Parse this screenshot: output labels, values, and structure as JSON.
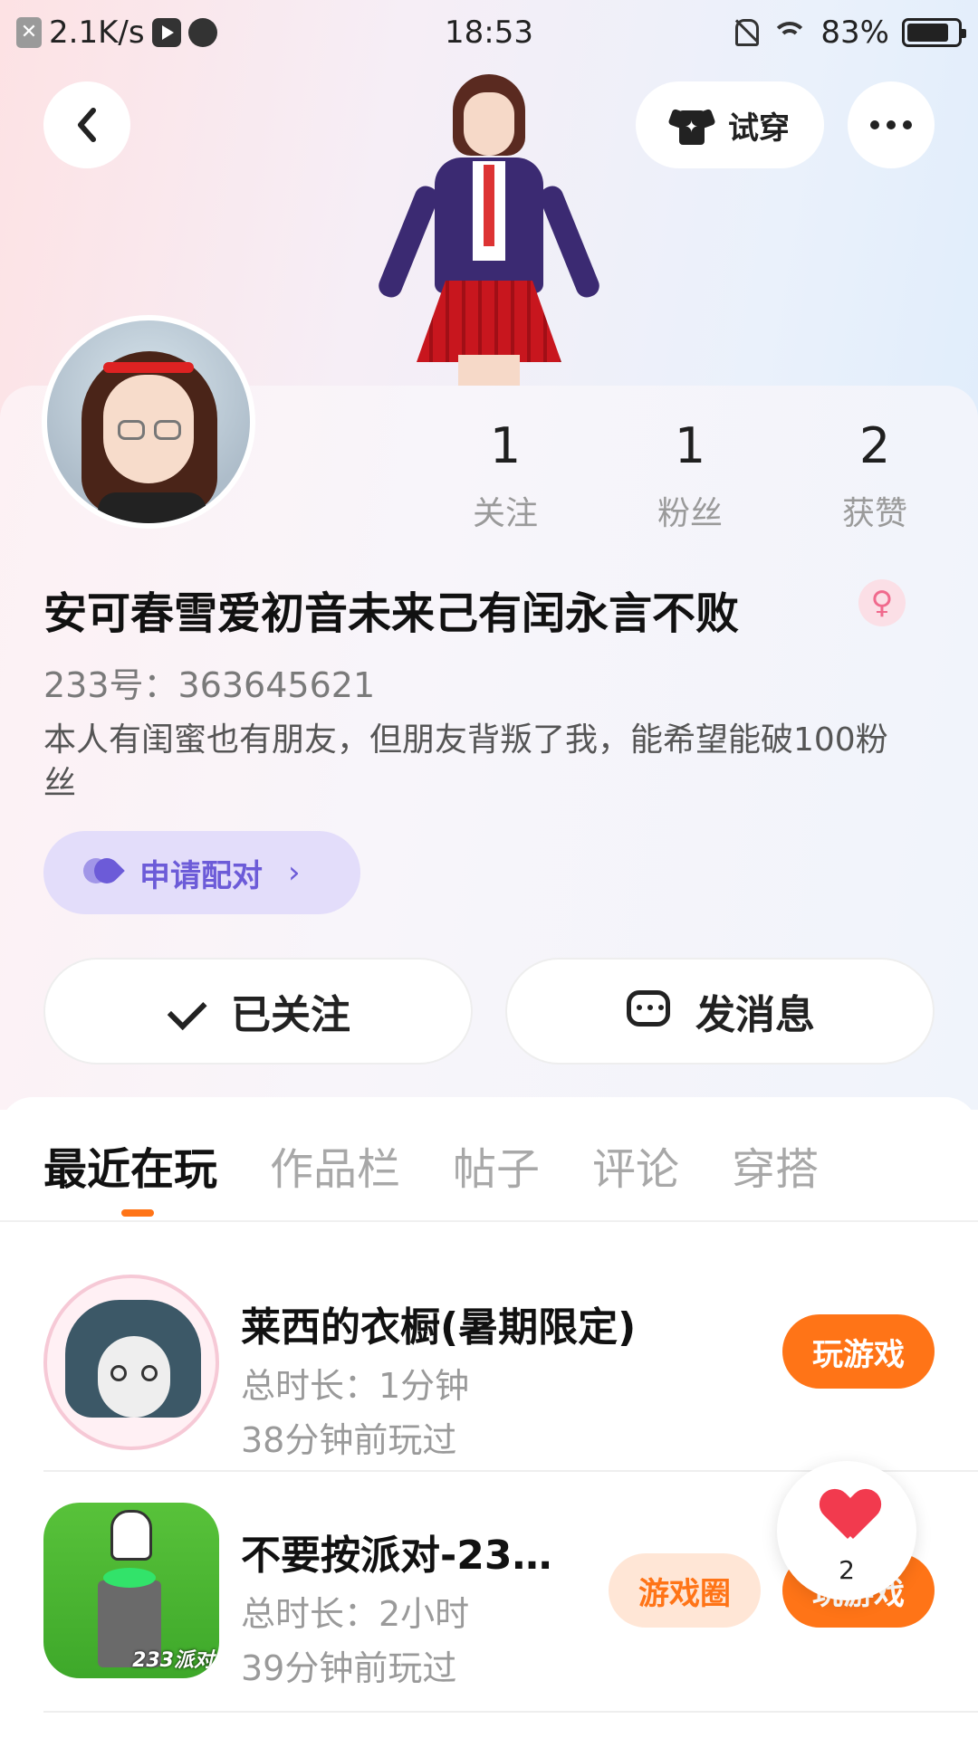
{
  "status_bar": {
    "net_speed": "2.1K/s",
    "time": "18:53",
    "battery": "83%",
    "battery_level": 0.83
  },
  "header": {
    "try_on_label": "试穿"
  },
  "profile": {
    "stats": [
      {
        "value": "1",
        "label": "关注"
      },
      {
        "value": "1",
        "label": "粉丝"
      },
      {
        "value": "2",
        "label": "获赞"
      }
    ],
    "username": "安可春雪爱初音未来己有闰永言不败",
    "gender": "female",
    "uid": "233号：363645621",
    "bio": "本人有闺蜜也有朋友，但朋友背叛了我，能希望能破100粉丝",
    "pair_label": "申请配对",
    "follow_label": "已关注",
    "message_label": "发消息"
  },
  "tabs": [
    "最近在玩",
    "作品栏",
    "帖子",
    "评论",
    "穿搭"
  ],
  "active_tab": "最近在玩",
  "games": [
    {
      "title": "莱西的衣橱(暑期限定)",
      "duration": "总时长：1分钟",
      "last_played": "38分钟前玩过",
      "play_label": "玩游戏"
    },
    {
      "title": "不要按派对-23…",
      "duration": "总时长：2小时",
      "last_played": "39分钟前玩过",
      "circle_label": "游戏圈",
      "play_label": "玩游戏",
      "icon_text": "233派对"
    }
  ],
  "like_float": {
    "count": "2"
  },
  "colors": {
    "accent": "#ff7417",
    "pair_purple": "#6c5bd8",
    "heart_red": "#f23a4e"
  }
}
